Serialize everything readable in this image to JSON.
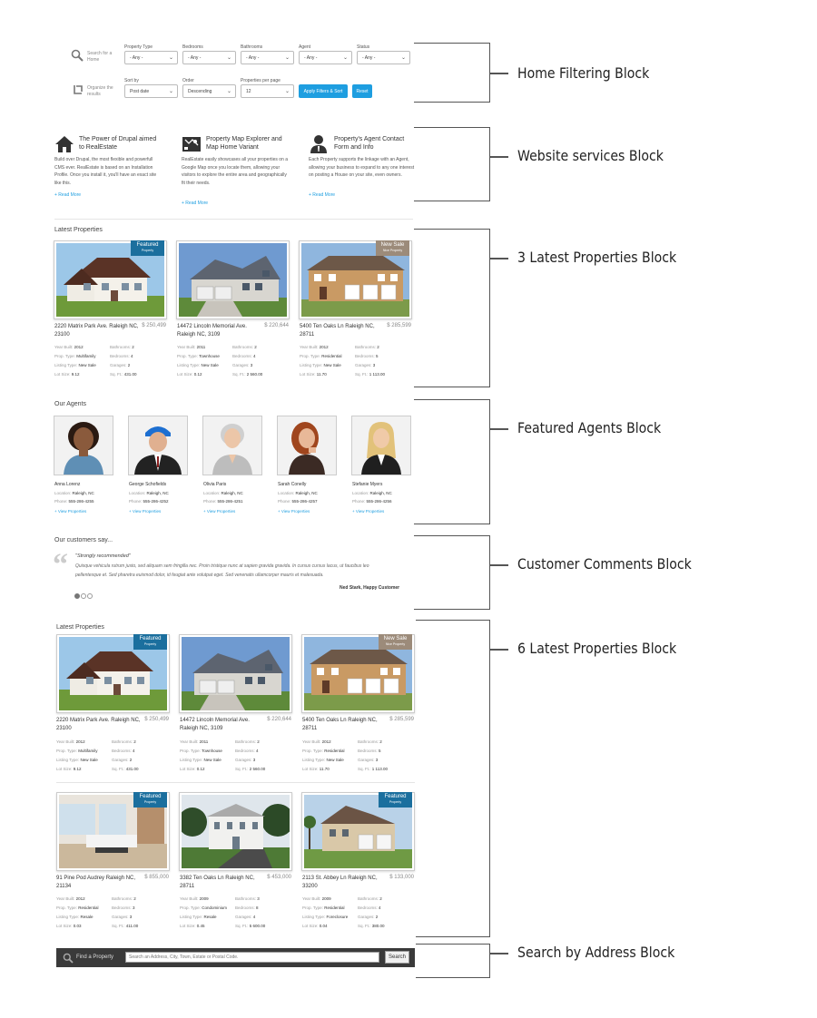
{
  "filter": {
    "search_label": "Search for a Home",
    "organize_label": "Organize the results",
    "fields": [
      {
        "label": "Property Type",
        "value": "- Any -"
      },
      {
        "label": "Bedrooms",
        "value": "- Any -"
      },
      {
        "label": "Bathrooms",
        "value": "- Any -"
      },
      {
        "label": "Agent",
        "value": "- Any -"
      },
      {
        "label": "Status",
        "value": "- Any -"
      }
    ],
    "sort": [
      {
        "label": "Sort by",
        "value": "Post date"
      },
      {
        "label": "Order",
        "value": "Descending"
      },
      {
        "label": "Properties per page",
        "value": "12"
      }
    ],
    "apply_button": "Apply Filters & Sort",
    "reset_button": "Reset"
  },
  "services": [
    {
      "title": "The Power of Drupal aimed to RealEstate",
      "text": "Build over Drupal, the most flexible and powerfull CMS ever. RealEstate is based on an Installation Profile. Once you install it, you'll have an exact site like this.",
      "link": "+ Read More"
    },
    {
      "title": "Property Map Explorer and Map Home Variant",
      "text": "RealEstate easily showcases all your properties on a Google Map once you locate them, allowing your visitors to explore the entire area and geographically fit their needs.",
      "link": "+ Read More"
    },
    {
      "title": "Property's Agent Contact Form and Info",
      "text": "Each Property supports the linkage with an Agent, allowing your business to expand to any one interest on posting a House on your site, even owners.",
      "link": "+ Read More"
    }
  ],
  "latest3": {
    "heading": "Latest Properties",
    "cards": [
      {
        "badge": "Featured",
        "badge_sub": "Property",
        "address": "2220 Matrix Park Ave. Raleigh NC, 23100",
        "price": "$ 250,499",
        "year": "2012",
        "type": "Multifamily",
        "listing": "New Sale",
        "lot": "9.12",
        "bathrooms": "2",
        "bedrooms": "4",
        "garages": "2",
        "sqft": "431.00"
      },
      {
        "badge": "",
        "badge_sub": "",
        "address": "14472 Lincoln Memorial Ave. Raleigh NC, 3109",
        "price": "$ 220,644",
        "year": "2011",
        "type": "Townhouse",
        "listing": "New Sale",
        "lot": "0.12",
        "bathrooms": "2",
        "bedrooms": "4",
        "garages": "3",
        "sqft": "2 560.00"
      },
      {
        "badge": "New Sale",
        "badge_sub": "Nice Property",
        "address": "5400 Ten Oaks Ln Raleigh NC, 28711",
        "price": "$ 285,599",
        "year": "2012",
        "type": "Residential",
        "listing": "New Sale",
        "lot": "11.70",
        "bathrooms": "2",
        "bedrooms": "5",
        "garages": "3",
        "sqft": "1 113.00"
      }
    ]
  },
  "spec_labels": {
    "year": "Year Built:",
    "type": "Prop. Type:",
    "listing": "Listing Type:",
    "lot": "Lot Size:",
    "bathrooms": "Bathrooms:",
    "bedrooms": "Bedrooms:",
    "garages": "Garages:",
    "sqft": "Sq. Ft.:"
  },
  "agents": {
    "heading": "Our Agents",
    "location_label": "Location:",
    "phone_label": "Phone:",
    "link": "+ View Properties",
    "list": [
      {
        "name": "Anna Lorenz",
        "location": "Raleigh, NC",
        "phone": "555-286-4255"
      },
      {
        "name": "George Schofields",
        "location": "Raleigh, NC",
        "phone": "555-286-4252"
      },
      {
        "name": "Olivia Paris",
        "location": "Raleigh, NC",
        "phone": "555-286-4251"
      },
      {
        "name": "Sarah Conelly",
        "location": "Raleigh, NC",
        "phone": "555-286-4257"
      },
      {
        "name": "Stefanie Myers",
        "location": "Raleigh, NC",
        "phone": "555-286-4256"
      }
    ]
  },
  "testimonial": {
    "heading": "Our customers say...",
    "quote_title": "\"Strongly recommended\"",
    "text1": "Quisque vehicula rutrum justo, sed aliquam sem fringilla nec. Proin tristique nunc at sapien gravida gravida. In cursus cursus lacus, ut faucibus leo",
    "text2": "pellentesque et. Sed pharetra euismod dolor, id feugiat ante volutpat eget. Sed venenatis ullamcorper mauris et malesuada.",
    "author": "Ned Stark, Happy Customer"
  },
  "latest6": {
    "heading": "Latest Properties",
    "cards": [
      {
        "badge": "Featured",
        "badge_sub": "Property",
        "address": "2220 Matrix Park Ave. Raleigh NC, 23100",
        "price": "$ 250,499",
        "year": "2012",
        "type": "Multifamily",
        "listing": "New Sale",
        "lot": "9.12",
        "bathrooms": "2",
        "bedrooms": "4",
        "garages": "2",
        "sqft": "431.00"
      },
      {
        "badge": "",
        "badge_sub": "",
        "address": "14472 Lincoln Memorial Ave. Raleigh NC, 3109",
        "price": "$ 220,644",
        "year": "2011",
        "type": "Townhouse",
        "listing": "New Sale",
        "lot": "0.12",
        "bathrooms": "2",
        "bedrooms": "4",
        "garages": "3",
        "sqft": "2 560.00"
      },
      {
        "badge": "New Sale",
        "badge_sub": "Nice Property",
        "address": "5400 Ten Oaks Ln Raleigh NC, 28711",
        "price": "$ 285,599",
        "year": "2012",
        "type": "Residential",
        "listing": "New Sale",
        "lot": "11.70",
        "bathrooms": "2",
        "bedrooms": "5",
        "garages": "3",
        "sqft": "1 113.00"
      },
      {
        "badge": "Featured",
        "badge_sub": "Property",
        "address": "91 Pine Pod Audrey Raleigh NC, 21134",
        "price": "$ 855,000",
        "year": "2012",
        "type": "Residential",
        "listing": "Resale",
        "lot": "0.03",
        "bathrooms": "2",
        "bedrooms": "3",
        "garages": "3",
        "sqft": "411.00"
      },
      {
        "badge": "",
        "badge_sub": "",
        "address": "3382 Ten Oaks Ln Raleigh NC, 28711",
        "price": "$ 453,000",
        "year": "2009",
        "type": "Condominium",
        "listing": "Resale",
        "lot": "0.45",
        "bathrooms": "3",
        "bedrooms": "8",
        "garages": "4",
        "sqft": "5 600.00"
      },
      {
        "badge": "Featured",
        "badge_sub": "Property",
        "address": "2113 St. Abbey Ln Raleigh NC, 33200",
        "price": "$ 133,000",
        "year": "2009",
        "type": "Residential",
        "listing": "Foreclosure",
        "lot": "0.04",
        "bathrooms": "2",
        "bedrooms": "4",
        "garages": "2",
        "sqft": "380.00"
      }
    ]
  },
  "search_bar": {
    "label": "Find a Property",
    "placeholder": "Search an Address, City, Town, Estate or Postal Code.",
    "button": "Search"
  },
  "annotations": [
    "Home Filtering Block",
    "Website services Block",
    "3 Latest Properties Block",
    "Featured Agents Block",
    "Customer Comments Block",
    "6 Latest Properties Block",
    "Search by Address Block"
  ],
  "colors": {
    "accent": "#1e9ee0",
    "featured_badge": "#1b6f9e",
    "newsale_badge": "#9c8b7a",
    "search_bar_bg": "#3a3a3a"
  }
}
